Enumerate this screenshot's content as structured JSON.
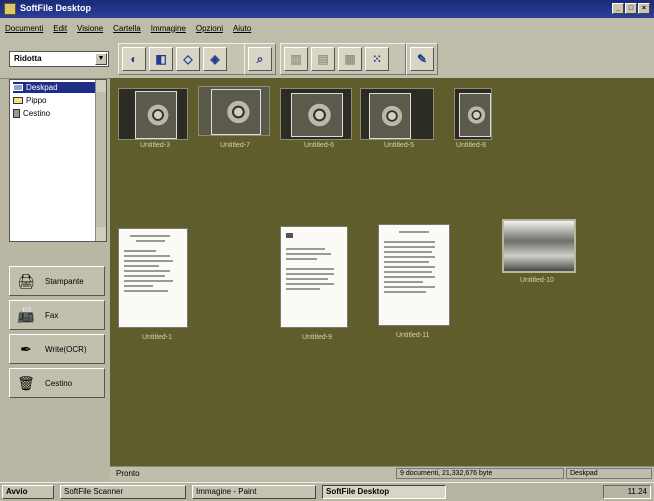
{
  "window": {
    "title": "SoftFile Desktop",
    "buttons": [
      "_",
      "□",
      "×"
    ]
  },
  "menu": {
    "items": [
      "Documenti",
      "Edit",
      "Visione",
      "Cartella",
      "Immagine",
      "Opzioni",
      "Aiuto"
    ]
  },
  "toolbar": {
    "view_select": "Ridotta"
  },
  "tree": {
    "items": [
      "Deskpad",
      "Pippo",
      "Cestino"
    ]
  },
  "actions": [
    "Stampante",
    "Fax",
    "Write(OCR)",
    "Cestino"
  ],
  "thumbnails": {
    "row1": [
      "Untitled-3",
      "Untitled-7",
      "Untitled-6",
      "Untitled-5",
      "Untitled-8"
    ],
    "row2": [
      "Untitled-1",
      "Untitled-9",
      "Untitled-11",
      "Untitled-10"
    ]
  },
  "status": {
    "ready": "Pronto",
    "documents": "9 documenti, 21,332,676 byte",
    "location": "Deskpad"
  },
  "taskbar": {
    "start": "Avvio",
    "tasks": [
      "SoftFile Scanner",
      "Immagine - Paint",
      "SoftFile Desktop"
    ],
    "clock": "11.24"
  }
}
